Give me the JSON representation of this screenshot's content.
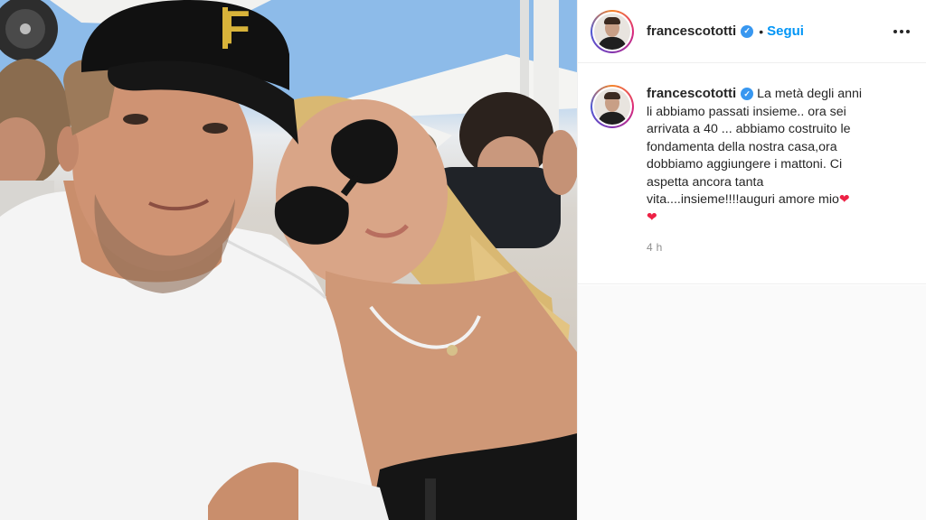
{
  "post": {
    "username": "francescototti",
    "verified_mark": "✓",
    "dot": "•",
    "follow_label": "Segui",
    "caption_lines": [
      "La metà degli anni",
      "li abbiamo passati insieme.. ora sei",
      "arrivata a 40 ... abbiamo costruito le",
      "fondamenta della nostra casa,ora",
      "dobbiamo aggiungere i mattoni. Ci",
      "aspetta ancora tanta",
      "vita....insieme!!!!auguri amore mio"
    ],
    "hearts": [
      "❤",
      "❤"
    ],
    "time": "4 h"
  },
  "photo": {
    "cap_logo": "F"
  },
  "icons": {
    "more": "more-options-icon",
    "verified": "verified-badge-icon"
  },
  "colors": {
    "link_blue": "#0095f6",
    "verified_blue": "#3897f0",
    "heart_red": "#ed2145"
  }
}
